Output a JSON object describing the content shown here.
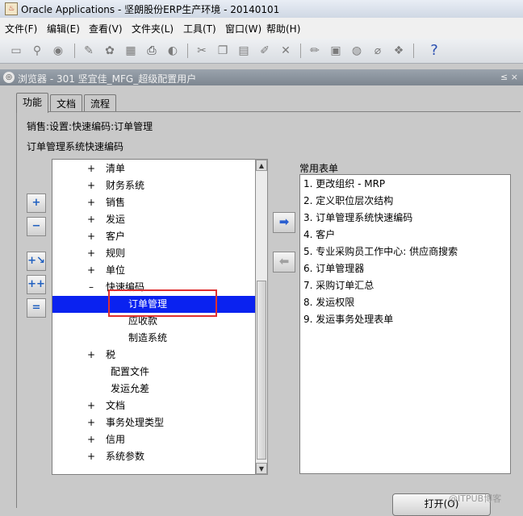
{
  "app_title": "Oracle Applications - 坚朗股份ERP生产环境 - 20140101",
  "menu": [
    "文件(F)",
    "编辑(E)",
    "查看(V)",
    "文件夹(L)",
    "工具(T)",
    "窗口(W)",
    "帮助(H)"
  ],
  "toolbar_icons": [
    "new-record-icon",
    "find-icon",
    "navigate-icon",
    "save-icon",
    "next-step-icon",
    "switch-resp-icon",
    "print-icon",
    "close-form-icon",
    "cut-icon",
    "copy-icon",
    "paste-icon",
    "clear-record-icon",
    "delete-icon",
    "edit-field-icon",
    "zoom-icon",
    "translations-icon",
    "attachments-icon",
    "folder-tools-icon",
    "help-icon"
  ],
  "navigator": {
    "title": "浏览器 - 301 坚宜佳_MFG_超级配置用户",
    "window_controls": "≤ ×",
    "tabs": [
      "功能",
      "文档",
      "流程"
    ],
    "path_label": "销售:设置:快速编码:订单管理",
    "tree_title": "订单管理系统快速编码",
    "favorites_label": "常用表单",
    "tree": [
      {
        "pm": "+",
        "text": "清单",
        "level": 1
      },
      {
        "pm": "+",
        "text": "财务系统",
        "level": 1
      },
      {
        "pm": "+",
        "text": "销售",
        "level": 1
      },
      {
        "pm": "+",
        "text": "发运",
        "level": 1
      },
      {
        "pm": "+",
        "text": "客户",
        "level": 1
      },
      {
        "pm": "+",
        "text": "规则",
        "level": 1
      },
      {
        "pm": "+",
        "text": "单位",
        "level": 1
      },
      {
        "pm": "–",
        "text": "快速编码",
        "level": 1
      },
      {
        "pm": "",
        "text": "订单管理",
        "level": 2,
        "selected": true
      },
      {
        "pm": "",
        "text": "应收款",
        "level": 2
      },
      {
        "pm": "",
        "text": "制造系统",
        "level": 2
      },
      {
        "pm": "+",
        "text": "税",
        "level": 1
      },
      {
        "pm": "",
        "text": "配置文件",
        "level": 1
      },
      {
        "pm": "",
        "text": "发运允差",
        "level": 1
      },
      {
        "pm": "+",
        "text": "文档",
        "level": 1
      },
      {
        "pm": "+",
        "text": "事务处理类型",
        "level": 1
      },
      {
        "pm": "+",
        "text": "信用",
        "level": 1
      },
      {
        "pm": "+",
        "text": "系统参数",
        "level": 1
      }
    ],
    "favorites": [
      "1. 更改组织 - MRP",
      "2. 定义职位层次结构",
      "3. 订单管理系统快速编码",
      "4. 客户",
      "5. 专业采购员工作中心: 供应商搜索",
      "6. 订单管理器",
      "7. 采购订单汇总",
      "8. 发运权限",
      "9. 发运事务处理表单"
    ],
    "open_button": "打开(O)",
    "watermark": "@ITPUB博客"
  }
}
